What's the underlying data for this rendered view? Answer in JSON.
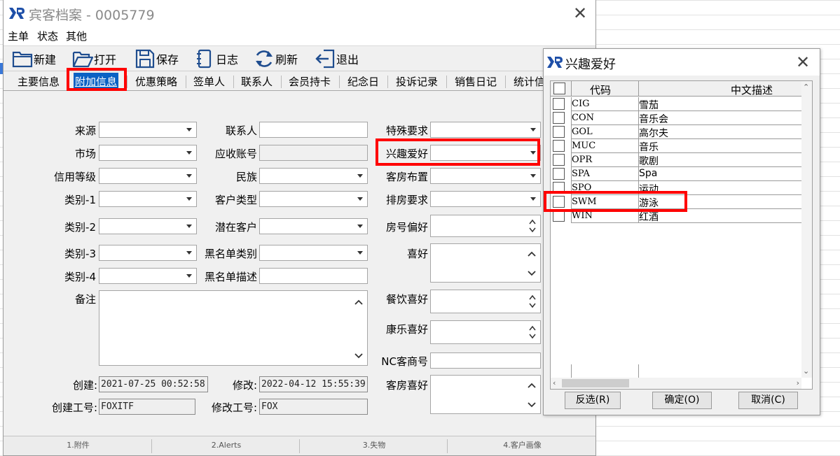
{
  "main_window": {
    "title": "宾客档案 - 0005779",
    "menu": [
      "主单",
      "状态",
      "其他"
    ],
    "toolbar": {
      "new": "新建",
      "open": "打开",
      "save": "保存",
      "log": "日志",
      "refresh": "刷新",
      "exit": "退出"
    },
    "tabs": [
      "主要信息",
      "附加信息",
      "优惠策略",
      "签单人",
      "联系人",
      "会员持卡",
      "纪念日",
      "投诉记录",
      "销售日记",
      "统计信"
    ],
    "selected_tab": "附加信息",
    "form": {
      "col1": {
        "source": "来源",
        "market": "市场",
        "credit_level": "信用等级",
        "category1": "类别-1",
        "category2": "类别-2",
        "category3": "类别-3",
        "category4": "类别-4",
        "remark": "备注"
      },
      "col2": {
        "contact": "联系人",
        "receivable_account": "应收账号",
        "ethnicity": "民族",
        "customer_type": "客户类型",
        "potential_customer": "潜在客户",
        "blacklist_category": "黑名单类别",
        "blacklist_desc": "黑名单描述"
      },
      "col3": {
        "special_request": "特殊要求",
        "interests": "兴趣爱好",
        "room_layout": "客房布置",
        "room_assign_request": "排房要求",
        "room_number_pref": "房号偏好",
        "hobbies": "喜好",
        "dining_pref": "餐饮喜好",
        "entertainment_pref": "康乐喜好",
        "nc_vendor_no": "NC客商号",
        "room_pref": "客房喜好"
      },
      "created_label": "创建:",
      "created_value": "2021-07-25 00:52:58",
      "modified_label": "修改:",
      "modified_value": "2022-04-12 15:55:39",
      "creator_id_label": "创建工号:",
      "creator_id_value": "FOXITF",
      "modifier_id_label": "修改工号:",
      "modifier_id_value": "FOX"
    },
    "status_bar": [
      "1.附件",
      "2.Alerts",
      "3.失物",
      "4.客户画像"
    ]
  },
  "dialog": {
    "title": "兴趣爱好",
    "columns": {
      "code": "代码",
      "desc": "中文描述"
    },
    "rows": [
      {
        "code": "CIG",
        "desc": "雪茄"
      },
      {
        "code": "CON",
        "desc": "音乐会"
      },
      {
        "code": "GOL",
        "desc": "高尔夫"
      },
      {
        "code": "MUC",
        "desc": "音乐"
      },
      {
        "code": "OPR",
        "desc": "歌剧"
      },
      {
        "code": "SPA",
        "desc": "Spa"
      },
      {
        "code": "SPO",
        "desc": "运动"
      },
      {
        "code": "SWM",
        "desc": "游泳"
      },
      {
        "code": "WIN",
        "desc": "红酒"
      }
    ],
    "buttons": {
      "invert": "反选(R)",
      "ok": "确定(O)",
      "cancel": "取消(C)"
    }
  },
  "colors": {
    "selected_tab_bg": "#0a62c4",
    "highlight_box": "#ff0000",
    "logo_blue": "#1e4fa8"
  }
}
